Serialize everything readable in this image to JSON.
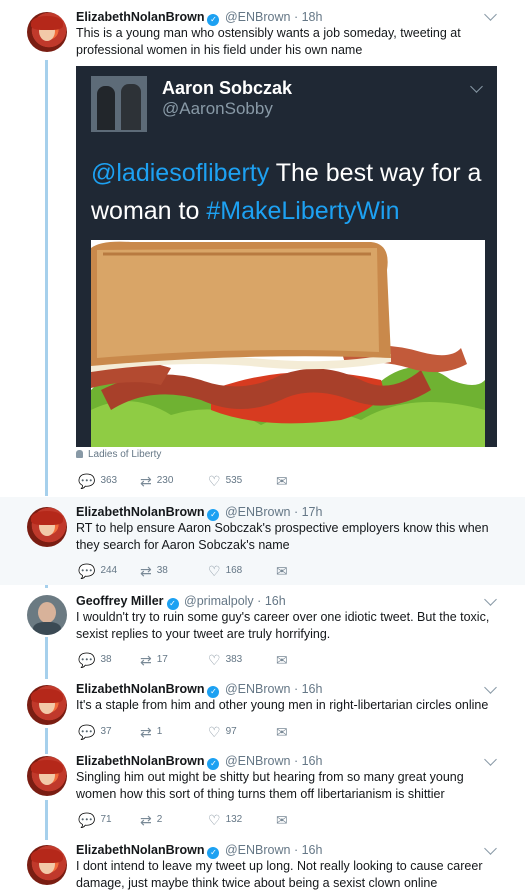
{
  "tweets": [
    {
      "name": "ElizabethNolanBrown",
      "handle": "@ENBrown",
      "time": "18h",
      "text": "This is a young man who ostensibly wants a job someday, tweeting at professional women in his field under his own name",
      "embed": {
        "name": "Aaron Sobczak",
        "handle": "@AaronSobby",
        "mention": "@ladiesofliberty",
        "text_mid": " The best way for a woman to ",
        "hashtag": "#MakeLibertyWin",
        "image": "sandwich-image"
      },
      "attribution": "Ladies of Liberty",
      "replies": "363",
      "retweets": "230",
      "likes": "535"
    },
    {
      "name": "ElizabethNolanBrown",
      "handle": "@ENBrown",
      "time": "17h",
      "text": "RT to help ensure Aaron Sobczak's prospective employers know this when they search for Aaron Sobczak's name",
      "replies": "244",
      "retweets": "38",
      "likes": "168"
    },
    {
      "name": "Geoffrey Miller",
      "handle": "@primalpoly",
      "time": "16h",
      "text": "I wouldn't try to ruin some guy's career over one idiotic tweet. But the toxic, sexist replies to your tweet are truly horrifying.",
      "replies": "38",
      "retweets": "17",
      "likes": "383"
    },
    {
      "name": "ElizabethNolanBrown",
      "handle": "@ENBrown",
      "time": "16h",
      "text": "It's a staple from him and other young men in right-libertarian circles online",
      "replies": "37",
      "retweets": "1",
      "likes": "97"
    },
    {
      "name": "ElizabethNolanBrown",
      "handle": "@ENBrown",
      "time": "16h",
      "text": "Singling him out might be shitty but hearing from so many great young women how this sort of thing turns them off libertarianism is shittier",
      "replies": "71",
      "retweets": "2",
      "likes": "132"
    },
    {
      "name": "ElizabethNolanBrown",
      "handle": "@ENBrown",
      "time": "16h",
      "text": "I dont intend to leave my tweet up long. Not really looking to cause career damage, just maybe think twice about being a sexist clown online"
    }
  ],
  "icons": {
    "reply": "reply-icon",
    "retweet": "retweet-icon",
    "like": "heart-icon",
    "dm": "envelope-icon",
    "verified": "verified-badge-icon",
    "caret": "chevron-down-icon"
  },
  "colors": {
    "link": "#1da1f2",
    "thread_line": "#a6d0ec",
    "highlight_bg": "#f5f8fa",
    "card_bg": "#1f2834"
  },
  "glyphs": {
    "reply": "💬",
    "retweet": "⇄",
    "like": "♡",
    "dm": "✉",
    "check": "✓",
    "dot": "·"
  }
}
